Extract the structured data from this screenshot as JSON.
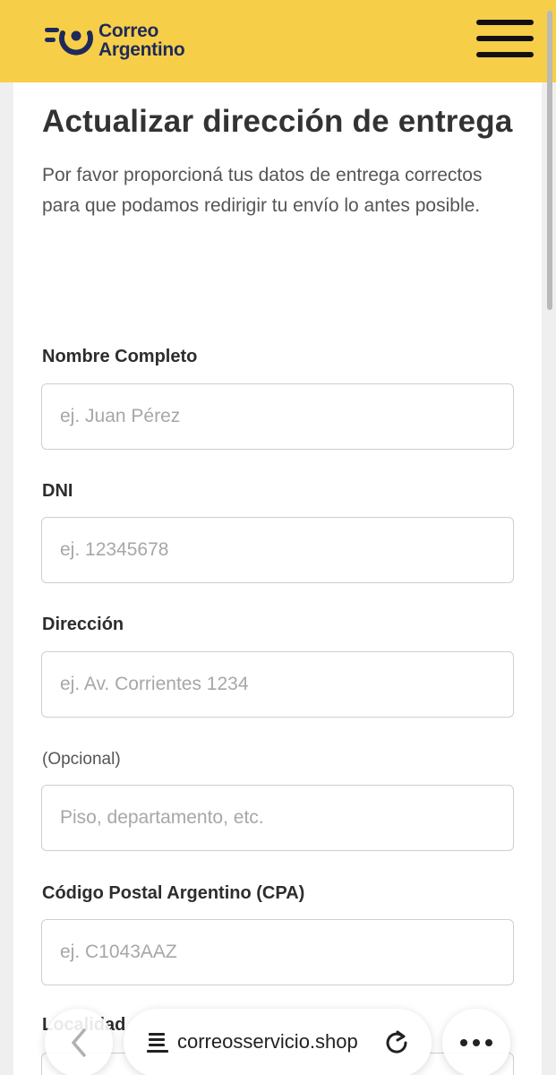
{
  "header": {
    "logo_line1": "Correo",
    "logo_line2": "Argentino",
    "brand_color": "#f7ce47",
    "logo_color": "#1f2a5a",
    "menu_icon": "hamburger-icon"
  },
  "main": {
    "title": "Actualizar dirección de entrega",
    "intro": "Por favor proporcioná tus datos de entrega correctos para que podamos redirigir tu envío lo antes posible."
  },
  "form": {
    "fields": [
      {
        "label": "Nombre Completo",
        "placeholder": "ej. Juan Pérez",
        "value": ""
      },
      {
        "label": "DNI",
        "placeholder": "ej. 12345678",
        "value": ""
      },
      {
        "label": "Dirección",
        "placeholder": "ej. Av. Corrientes 1234",
        "value": ""
      },
      {
        "label": "(Opcional)",
        "placeholder": "Piso, departamento, etc.",
        "value": ""
      },
      {
        "label": "Código Postal Argentino (CPA)",
        "placeholder": "ej. C1043AAZ",
        "value": ""
      }
    ],
    "next_label_partial": "Localidad"
  },
  "browser": {
    "url": "correosservicio.shop",
    "icons": [
      "back-icon",
      "reader-icon",
      "reload-icon",
      "more-icon"
    ]
  }
}
